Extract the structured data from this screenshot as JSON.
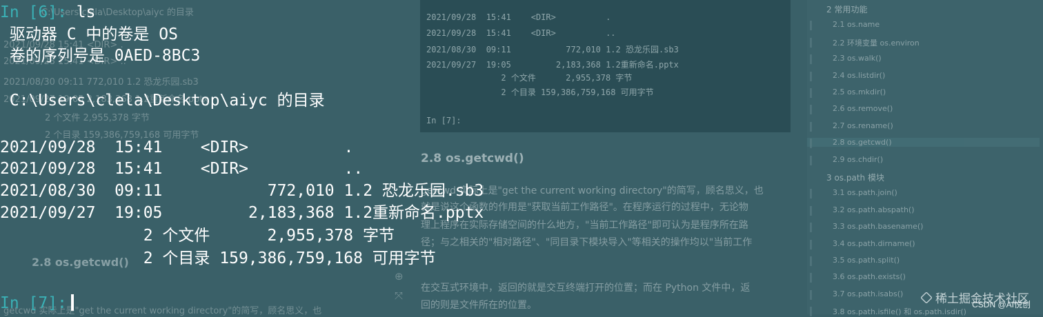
{
  "background": {
    "left_column": [
      "In [6]: ls",
      "驱动器 C 中的卷是 OS",
      "卷的序列号是 0AED-8BC3",
      "C:\\Users\\clela\\Desktop\\aiyc 的目录",
      "2021/09/28  15:41    <DIR>          .",
      "2021/09/28  15:41    <DIR>          ..",
      "2021/08/30  09:11           772,010 1.2 恐龙乐园.sb3",
      "2021/09/27  19:05         2,183,368 1.2重新命名.pptx",
      "2 个文件      2,955,378 字节",
      "2 个目录 159,386,759,168 可用字节"
    ],
    "left_heading": "2.8 os.getcwd()",
    "left_footer": "getcwd 实际上是\"get the current working directory\"的简写，顾名思义，也",
    "panel_lines": [
      "2021/09/28  15:41    <DIR>          .",
      "2021/09/28  15:41    <DIR>          ..",
      "2021/08/30  09:11           772,010 1.2 恐龙乐园.sb3",
      "2021/09/27  19:05         2,183,368 1.2重新命名.pptx",
      "               2 个文件      2,955,378 字节",
      "               2 个目录 159,386,759,168 可用字节",
      "In [7]:"
    ],
    "article_title": "2.8 os.getcwd()",
    "article_lines": [
      "getcwd 实际上是\"get the current working directory\"的简写，顾名思义，也",
      "就是说这个函数的作用是\"获取当前工作路径\"。在程序运行的过程中，无论物",
      "理上程序在实际存储空间的什么地方，\"当前工作路径\"即可认为是程序所在路",
      "径；与之相关的\"相对路径\"、\"同目录下模块导入\"等相关的操作均以\"当前工作",
      "",
      "在交互式环境中，返回的就是交互终端打开的位置；而在 Python 文件中，返",
      "回的则是文件所在的位置。"
    ],
    "sidebar": [
      {
        "label": "2  常用功能",
        "sec": true
      },
      {
        "label": "2.1 os.name"
      },
      {
        "label": "2.2 环境变量 os.environ"
      },
      {
        "label": "2.3 os.walk()"
      },
      {
        "label": "2.4 os.listdir()"
      },
      {
        "label": "2.5 os.mkdir()"
      },
      {
        "label": "2.6 os.remove()"
      },
      {
        "label": "2.7 os.rename()"
      },
      {
        "label": "2.8 os.getcwd()",
        "active": true
      },
      {
        "label": "2.9 os.chdir()"
      },
      {
        "label": "3  os.path 模块",
        "sec": true
      },
      {
        "label": "3.1 os.path.join()"
      },
      {
        "label": "3.2 os.path.abspath()"
      },
      {
        "label": "3.3 os.path.basename()"
      },
      {
        "label": "3.4 os.path.dirname()"
      },
      {
        "label": "3.5 os.path.split()"
      },
      {
        "label": "3.6 os.path.exists()"
      },
      {
        "label": "3.7 os.path.isabs()"
      },
      {
        "label": "3.8 os.path.isfile() 和 os.path.isdir()"
      }
    ]
  },
  "terminal": {
    "prompt1": "In [6]:",
    "command": "ls",
    "volume_line": " 驱动器 C 中的卷是 OS",
    "serial_line": " 卷的序列号是 0AED-8BC3",
    "dir_header": " C:\\Users\\clela\\Desktop\\aiyc 的目录",
    "entries": [
      "2021/09/28  15:41    <DIR>          .",
      "2021/09/28  15:41    <DIR>          ..",
      "2021/08/30  09:11           772,010 1.2 恐龙乐园.sb3",
      "2021/09/27  19:05         2,183,368 1.2重新命名.pptx"
    ],
    "files_summary": "               2 个文件      2,955,378 字节",
    "dirs_summary": "               2 个目录 159,386,759,168 可用字节",
    "prompt2": "In [7]:"
  },
  "watermark": {
    "main": "稀土掘金技术社区",
    "sub": "CSDN @AI悦创"
  },
  "colors": {
    "background": "#3a6068",
    "prompt": "#3ab0b5",
    "text": "#ffffff"
  }
}
